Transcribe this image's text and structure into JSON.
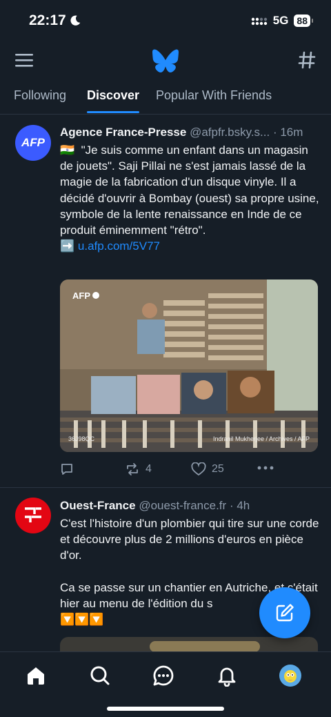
{
  "status_bar": {
    "time": "22:17",
    "network": "5G",
    "battery": "88"
  },
  "tabs": [
    {
      "label": "Following"
    },
    {
      "label": "Discover"
    },
    {
      "label": "Popular With Friends"
    }
  ],
  "posts": [
    {
      "avatar_text": "AFP",
      "author": "Agence France-Presse",
      "handle": "@afpfr.bsky.s...",
      "time": "16m",
      "flag": "🇮🇳",
      "text": "\"Je suis comme un enfant dans un magasin de jouets\". Saji Pillai ne s'est jamais lassé de la magie de la fabrication d'un disque vinyle. Il a décidé d'ouvrir à Bombay (ouest) sa propre usine, symbole de la lente renaissance en Inde de ce produit éminemment \"rétro\".",
      "arrow": "➡️",
      "link": "u.afp.com/5V77",
      "image_watermark": "AFP",
      "image_code": "36J98QC",
      "image_credit": "Indranil Mukherjee / Archives / AFP",
      "replies": "",
      "reposts": "4",
      "likes": "25"
    },
    {
      "author": "Ouest-France",
      "handle": "@ouest-france.fr",
      "time": "4h",
      "text": "C'est l'histoire d'un plombier qui tire sur une corde et découvre plus de 2 millions d'euros en pièce d'or.",
      "text2": "Ca se passe sur un chantier en Autriche, et c'était hier au menu de l'édition du s",
      "emoji_line": "🔽🔽🔽"
    }
  ],
  "colors": {
    "accent": "#208bfe",
    "background": "#161e27",
    "muted": "#8d9aaa"
  },
  "icons": [
    "menu-icon",
    "butterfly-logo-icon",
    "hash-icon",
    "reply-icon",
    "repost-icon",
    "heart-icon",
    "more-icon",
    "compose-icon",
    "home-icon",
    "search-icon",
    "chat-icon",
    "bell-icon",
    "profile-avatar"
  ]
}
